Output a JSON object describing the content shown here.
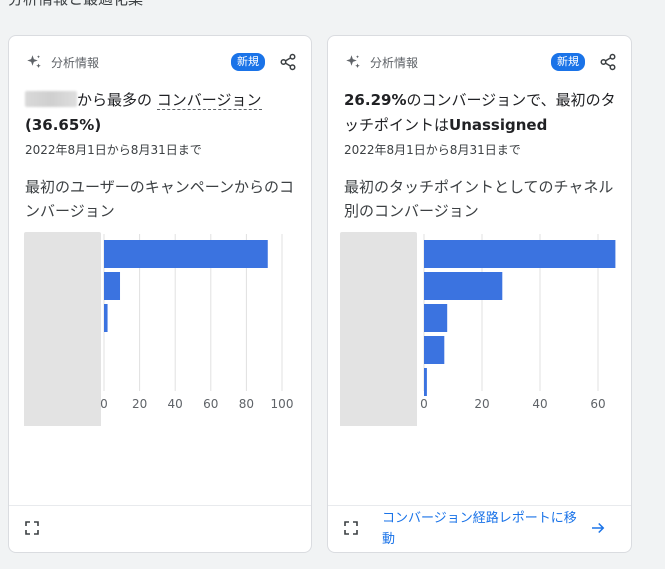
{
  "section_title": "分析情報と最適化案",
  "cards": [
    {
      "label": "分析情報",
      "badge": "新規",
      "headline_mid": "から最多の",
      "headline_link": "コンバージョン",
      "headline_pct": "(36.65%)",
      "date_range": "2022年8月1日から8月31日まで",
      "chart_title": "最初のユーザーのキャンペーンからのコンバージョン"
    },
    {
      "label": "分析情報",
      "badge": "新規",
      "headline_pct": "26.29%",
      "headline_text": "のコンバージョンで、最初のタッチポイントは",
      "headline_value": "Unassigned",
      "date_range": "2022年8月1日から8月31日まで",
      "chart_title": "最初のタッチポイントとしてのチャネル別のコンバージョン",
      "footer_link": "コンバージョン経路レポートに移動"
    }
  ],
  "chart_data": [
    {
      "type": "bar",
      "orientation": "horizontal",
      "categories_blurred": true,
      "values": [
        92,
        9,
        2,
        0,
        0
      ],
      "xlim": [
        0,
        100
      ],
      "xticks": [
        "0",
        "20",
        "40",
        "60",
        "80",
        "100"
      ],
      "color": "#3b73e0"
    },
    {
      "type": "bar",
      "orientation": "horizontal",
      "categories_blurred": true,
      "values": [
        66,
        27,
        8,
        7,
        1
      ],
      "xlim": [
        0,
        70
      ],
      "xticks": [
        "0",
        "20",
        "40",
        "60"
      ],
      "color": "#3b73e0"
    }
  ],
  "colors": {
    "accent": "#1a73e8",
    "bar": "#3b73e0"
  }
}
